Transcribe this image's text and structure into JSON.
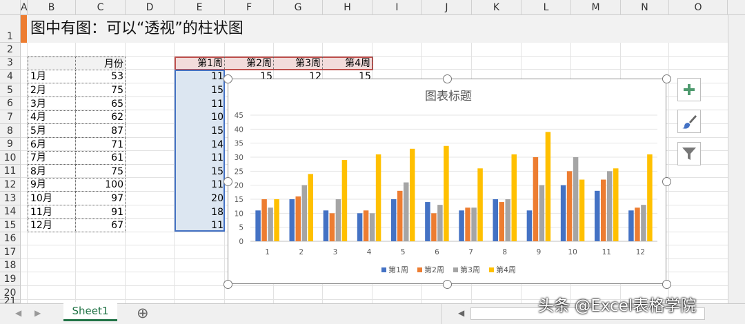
{
  "sheet": {
    "title": "图中有图：可以“透视”的柱状图",
    "columns": [
      "A",
      "B",
      "C",
      "D",
      "E",
      "F",
      "G",
      "H",
      "I",
      "J",
      "K",
      "L",
      "M",
      "N",
      "O"
    ],
    "rows": [
      "1",
      "2",
      "3",
      "4",
      "5",
      "6",
      "7",
      "8",
      "9",
      "10",
      "11",
      "12",
      "13",
      "14",
      "15",
      "16",
      "17",
      "18",
      "19",
      "20",
      "21"
    ],
    "month_table": {
      "header": "月份",
      "months": [
        "1月",
        "2月",
        "3月",
        "4月",
        "5月",
        "6月",
        "7月",
        "8月",
        "9月",
        "10月",
        "11月",
        "12月"
      ],
      "values": [
        "53",
        "75",
        "65",
        "62",
        "87",
        "71",
        "61",
        "75",
        "100",
        "97",
        "91",
        "67"
      ]
    },
    "week_table": {
      "headers": [
        "第1周",
        "第2周",
        "第3周",
        "第4周"
      ],
      "visible_cells": [
        [
          "11",
          "15",
          "12",
          "15"
        ],
        [
          "15"
        ],
        [
          "11"
        ],
        [
          "10"
        ],
        [
          "15"
        ],
        [
          "14"
        ],
        [
          "11"
        ],
        [
          "15"
        ],
        [
          "11"
        ],
        [
          "20"
        ],
        [
          "18"
        ],
        [
          "11"
        ]
      ]
    }
  },
  "chart_side_buttons": [
    "plus-icon",
    "brush-icon",
    "filter-icon"
  ],
  "footer": {
    "sheet_tab": "Sheet1",
    "add_sheet": "⊕",
    "watermark": "头条 @Excel表格学院"
  },
  "colors": {
    "accent": "#ed7d31",
    "series": [
      "#4472c4",
      "#ed7d31",
      "#a5a5a5",
      "#ffc000"
    ]
  },
  "chart_data": {
    "type": "bar",
    "title": "图表标题",
    "categories": [
      "1",
      "2",
      "3",
      "4",
      "5",
      "6",
      "7",
      "8",
      "9",
      "10",
      "11",
      "12"
    ],
    "ylim": [
      0,
      45
    ],
    "yticks": [
      "0",
      "5",
      "10",
      "15",
      "20",
      "25",
      "30",
      "35",
      "40",
      "45"
    ],
    "grid": true,
    "legend": "bottom",
    "series": [
      {
        "name": "第1周",
        "values": [
          11,
          15,
          11,
          10,
          15,
          14,
          11,
          15,
          11,
          20,
          18,
          11
        ]
      },
      {
        "name": "第2周",
        "values": [
          15,
          16,
          10,
          11,
          18,
          10,
          12,
          14,
          30,
          25,
          22,
          12
        ]
      },
      {
        "name": "第3周",
        "values": [
          12,
          20,
          15,
          10,
          21,
          13,
          12,
          15,
          20,
          30,
          25,
          13
        ]
      },
      {
        "name": "第4周",
        "values": [
          15,
          24,
          29,
          31,
          33,
          34,
          26,
          31,
          39,
          22,
          26,
          31
        ]
      }
    ]
  }
}
